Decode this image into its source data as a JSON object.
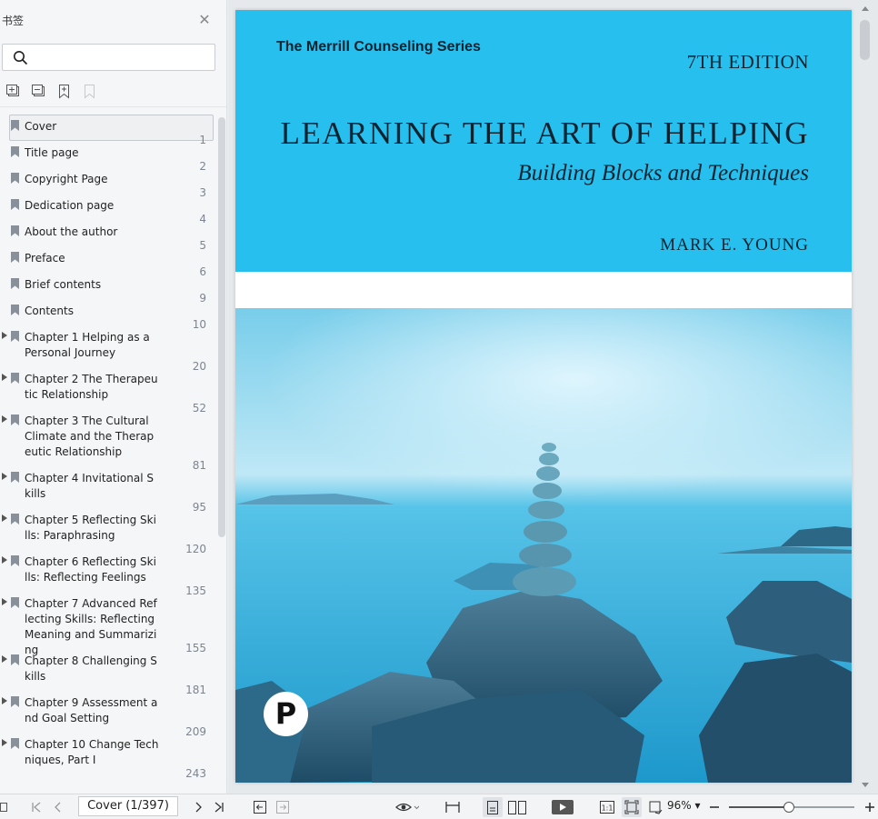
{
  "sidebar": {
    "title": "书签",
    "search_placeholder": "",
    "tools": [
      "expand-all-icon",
      "collapse-all-icon",
      "add-bookmark-icon",
      "remove-bookmark-icon"
    ],
    "items": [
      {
        "label": "Cover",
        "page": "1",
        "expandable": false,
        "selected": true
      },
      {
        "label": "Title page",
        "page": "2",
        "expandable": false
      },
      {
        "label": "Copyright Page",
        "page": "3",
        "expandable": false
      },
      {
        "label": "Dedication page",
        "page": "4",
        "expandable": false
      },
      {
        "label": "About the author",
        "page": "5",
        "expandable": false
      },
      {
        "label": "Preface",
        "page": "6",
        "expandable": false
      },
      {
        "label": "Brief contents",
        "page": "9",
        "expandable": false
      },
      {
        "label": "Contents",
        "page": "10",
        "expandable": false
      },
      {
        "label": "Chapter 1 Helping as a Personal Journey",
        "page": "20",
        "expandable": true
      },
      {
        "label": "Chapter 2 The Therapeutic Relationship",
        "page": "52",
        "expandable": true
      },
      {
        "label": "Chapter 3 The Cultural Climate and the Therapeutic Relationship",
        "page": "81",
        "expandable": true
      },
      {
        "label": "Chapter 4 Invitational Skills",
        "page": "95",
        "expandable": true
      },
      {
        "label": "Chapter 5 Reflecting Skills: Paraphrasing",
        "page": "120",
        "expandable": true
      },
      {
        "label": "Chapter 6 Reflecting Skills: Reflecting Feelings",
        "page": "135",
        "expandable": true
      },
      {
        "label": "Chapter 7 Advanced Reflecting Skills: Reflecting Meaning and Summarizing",
        "page": "155",
        "expandable": true
      },
      {
        "label": "Chapter 8 Challenging Skills",
        "page": "181",
        "expandable": true
      },
      {
        "label": "Chapter 9 Assessment and Goal Setting",
        "page": "209",
        "expandable": true
      },
      {
        "label": "Chapter 10 Change Techniques, Part I",
        "page": "243",
        "expandable": true
      }
    ]
  },
  "cover": {
    "series": "The Merrill Counseling Series",
    "edition": "7TH EDITION",
    "title": "LEARNING THE ART OF HELPING",
    "subtitle": "Building Blocks and Techniques",
    "author": "MARK E. YOUNG",
    "publisher_logo_letter": "P",
    "top_color": "#27bfee"
  },
  "statusbar": {
    "page_indicator": "Cover (1/397)",
    "zoom": "96%",
    "zoom_fraction": 0.48
  }
}
